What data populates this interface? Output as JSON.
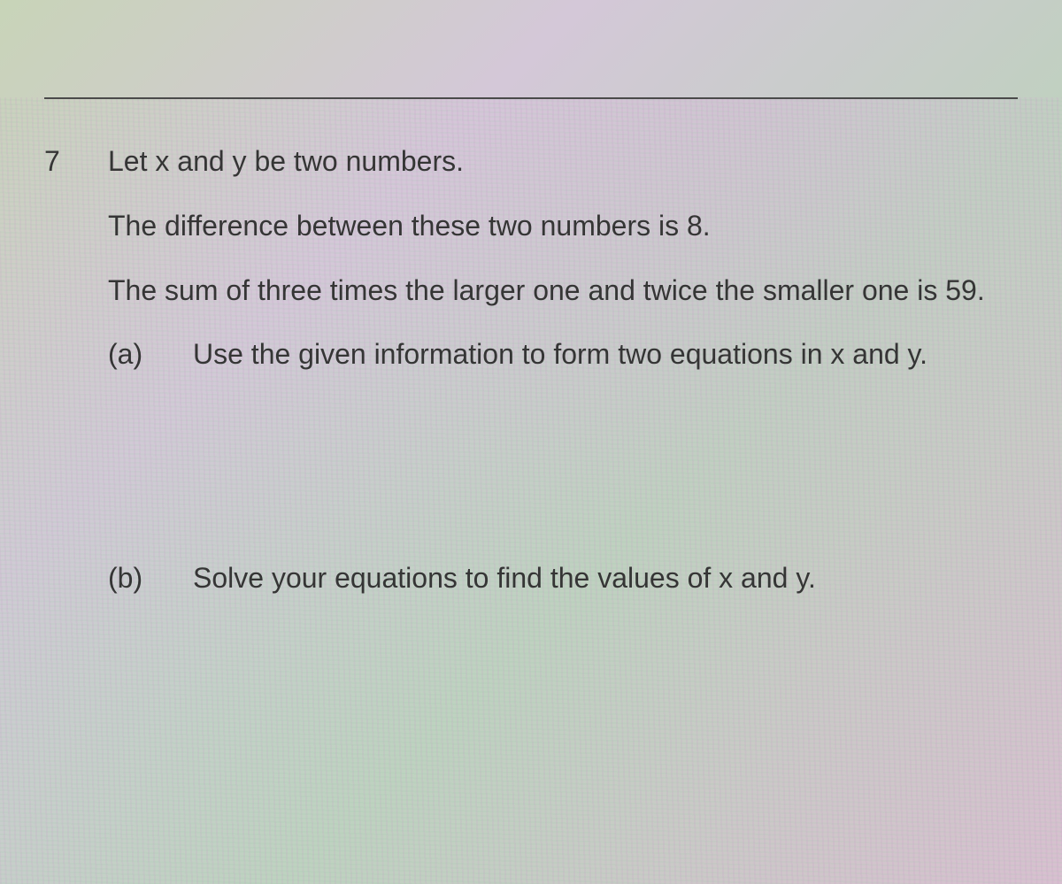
{
  "question": {
    "number": "7",
    "intro_line_1": "Let x and y be two numbers.",
    "intro_line_2": "The difference between these two numbers is 8.",
    "intro_line_3": "The sum of three times the larger one and twice the smaller one is 59.",
    "parts": {
      "a": {
        "label": "(a)",
        "text": "Use the given information to form two equations in x and y."
      },
      "b": {
        "label": "(b)",
        "text": "Solve your equations to find the values of x and y."
      }
    }
  }
}
